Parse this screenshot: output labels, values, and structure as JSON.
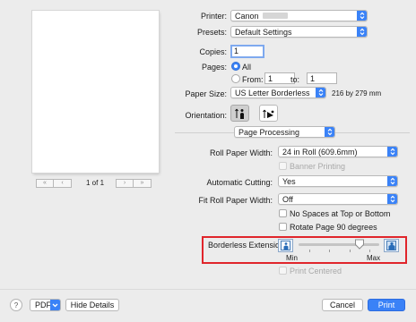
{
  "preview": {
    "page_count": "1 of 1",
    "nav_first_icon": "first-page-icon",
    "nav_prev_icon": "prev-page-icon",
    "nav_next_icon": "next-page-icon",
    "nav_last_icon": "last-page-icon"
  },
  "printer": {
    "label": "Printer:",
    "value": "Canon"
  },
  "presets": {
    "label": "Presets:",
    "value": "Default Settings"
  },
  "copies": {
    "label": "Copies:",
    "value": "1"
  },
  "pages": {
    "label": "Pages:",
    "all_label": "All",
    "from_label": "From:",
    "from_value": "1",
    "to_label": "to:",
    "to_value": "1",
    "selected": "All"
  },
  "paper_size": {
    "label": "Paper Size:",
    "value": "US Letter Borderless",
    "dimensions": "216 by 279 mm"
  },
  "orientation": {
    "label": "Orientation:",
    "selected": "portrait"
  },
  "section": {
    "value": "Page Processing"
  },
  "roll_paper_width": {
    "label": "Roll Paper Width:",
    "value": "24 in Roll (609.6mm)"
  },
  "banner_printing": {
    "label": "Banner Printing",
    "checked": false,
    "enabled": false
  },
  "automatic_cutting": {
    "label": "Automatic Cutting:",
    "value": "Yes"
  },
  "fit_roll_paper_width": {
    "label": "Fit Roll Paper Width:",
    "value": "Off"
  },
  "no_spaces": {
    "label": "No Spaces at Top or Bottom",
    "checked": false
  },
  "rotate_page": {
    "label": "Rotate Page 90 degrees",
    "checked": false
  },
  "borderless_extension": {
    "label": "Borderless Extension:",
    "min_label": "Min",
    "max_label": "Max",
    "level_fraction": 0.75
  },
  "print_centered": {
    "label": "Print Centered",
    "checked": false,
    "enabled": false
  },
  "footer": {
    "help_label": "?",
    "pdf_label": "PDF",
    "hide_details_label": "Hide Details",
    "cancel_label": "Cancel",
    "print_label": "Print"
  },
  "colors": {
    "accent": "#3a82f7",
    "highlight": "#e0252b"
  }
}
